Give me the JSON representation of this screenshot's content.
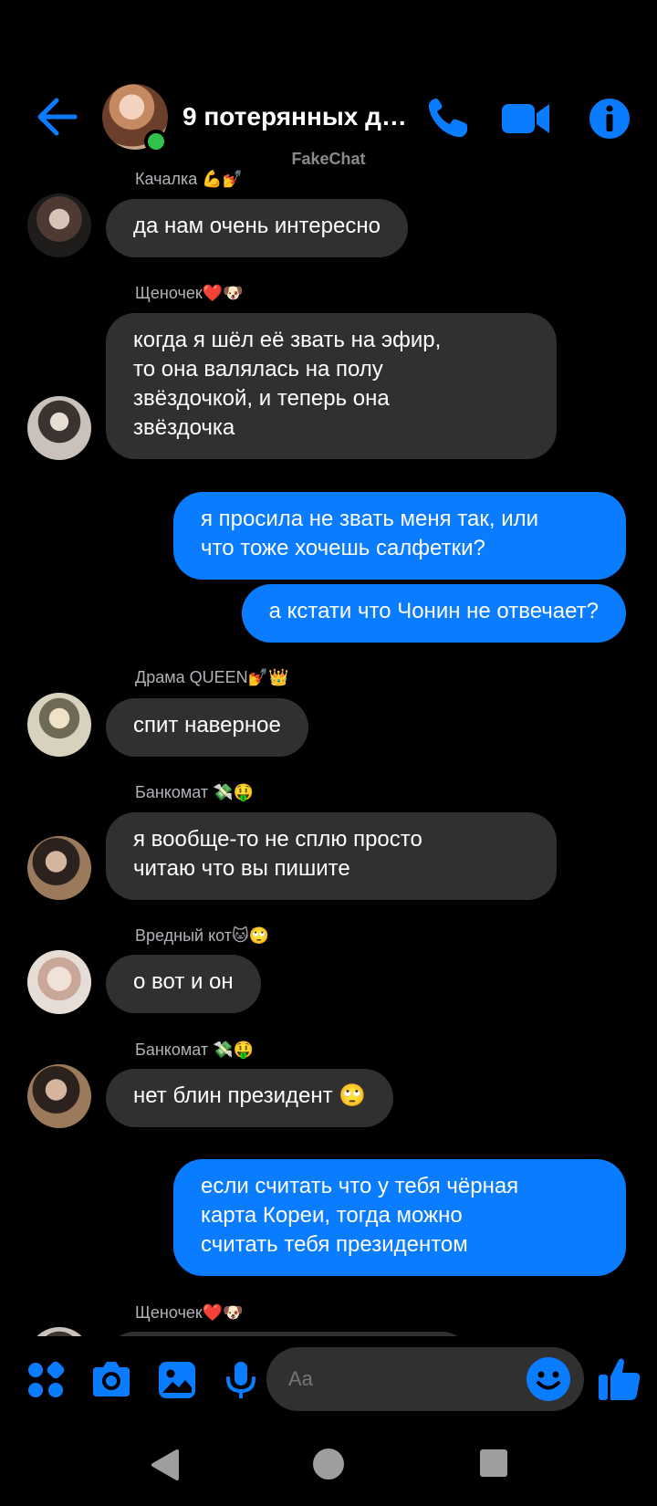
{
  "header": {
    "title": "9 потерянных де...",
    "watermark": "FakeChat",
    "icons": {
      "back": "arrow-left-icon",
      "phone": "phone-icon",
      "video": "video-camera-icon",
      "info": "info-icon"
    },
    "accent_color": "#0a7cff",
    "online_color": "#31c24d"
  },
  "messages": [
    {
      "sender": "Качалка 💪💅",
      "text": "да нам очень интересно",
      "direction": "incoming"
    },
    {
      "sender": "Щеночек❤️🐶",
      "text": "когда я шёл её звать на эфир,\nто она валялась на полу\nзвёздочкой, и теперь она\nзвёздочка",
      "direction": "incoming"
    },
    {
      "text": "я просила не звать меня так, или\nчто тоже хочешь салфетки?",
      "direction": "outgoing"
    },
    {
      "text": "а кстати что Чонин не отвечает?",
      "direction": "outgoing"
    },
    {
      "sender": "Драма QUEEN💅👑",
      "text": "спит наверное",
      "direction": "incoming"
    },
    {
      "sender": "Банкомат 💸🤑",
      "text": "я вообще-то не сплю просто\nчитаю что вы пишите",
      "direction": "incoming"
    },
    {
      "sender": "Вредный кот🐱🙄",
      "text": "о вот и он",
      "direction": "incoming"
    },
    {
      "sender": "Банкомат 💸🤑",
      "text": "нет блин президент 🙄",
      "direction": "incoming"
    },
    {
      "text": "если считать что у тебя чёрная\nкарта Кореи, тогда можно\nсчитать тебя президентом",
      "direction": "outgoing"
    },
    {
      "sender": "Щеночек❤️🐶",
      "direction": "incoming"
    }
  ],
  "composer": {
    "placeholder": "Aa",
    "icons": [
      "apps-icon",
      "camera-icon",
      "image-icon",
      "microphone-icon",
      "emoji-icon",
      "thumbs-up-icon"
    ]
  },
  "navbar": {
    "icons": [
      "nav-back-icon",
      "nav-home-icon",
      "nav-recents-icon"
    ]
  }
}
